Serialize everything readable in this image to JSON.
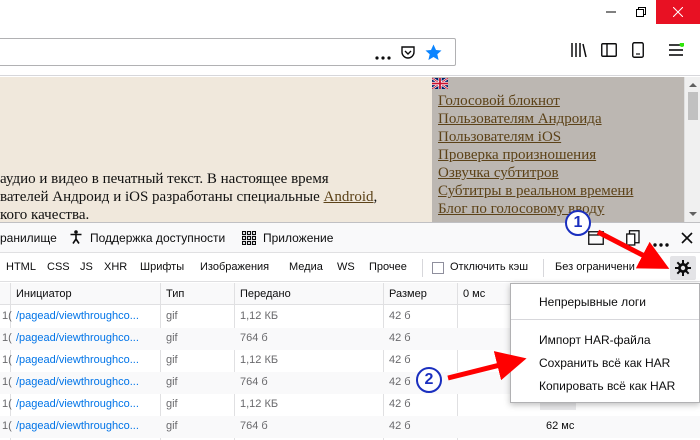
{
  "page": {
    "lines": [
      "аудио и видео в печатный текст. В настоящее время",
      "вателей Андроид и iOS разработаны специальные ",
      "кого качества."
    ],
    "android_link": "Android",
    "comma": ","
  },
  "sidebar": {
    "items": [
      "Голосовой блокнот",
      "Пользователям Андроида",
      "Пользователям iOS",
      "Проверка произношения",
      "Озвучка субтитров",
      "Субтитры в реальном времени",
      "Блог по голосовому вводу"
    ]
  },
  "devtools": {
    "tabs": [
      "ранилище",
      "Поддержка доступности",
      "Приложение"
    ],
    "filters": [
      "HTML",
      "CSS",
      "JS",
      "XHR",
      "Шрифты",
      "Изображения",
      "Медиа",
      "WS",
      "Прочее"
    ],
    "disable_cache": "Отключить кэш",
    "throttle": "Без ограничени",
    "columns": [
      "Инициатор",
      "Тип",
      "Передано",
      "Размер",
      "0 мс"
    ],
    "rows": [
      {
        "status": "1(",
        "initiator": "/pagead/viewthroughco...",
        "type": "gif",
        "transferred": "1,12 КБ",
        "size": "42 б"
      },
      {
        "status": "1(",
        "initiator": "/pagead/viewthroughco...",
        "type": "gif",
        "transferred": "764 б",
        "size": "42 б"
      },
      {
        "status": "1(",
        "initiator": "/pagead/viewthroughco...",
        "type": "gif",
        "transferred": "1,12 КБ",
        "size": "42 б"
      },
      {
        "status": "1(",
        "initiator": "/pagead/viewthroughco...",
        "type": "gif",
        "transferred": "764 б",
        "size": "42 б"
      },
      {
        "status": "1(",
        "initiator": "/pagead/viewthroughco...",
        "type": "gif",
        "transferred": "1,12 КБ",
        "size": "42 б"
      },
      {
        "status": "1(",
        "initiator": "/pagead/viewthroughco...",
        "type": "gif",
        "transferred": "764 б",
        "size": "42 б"
      }
    ],
    "waterfall_label": "62 мс"
  },
  "menu": {
    "items": [
      "Непрерывные логи",
      "Импорт HAR-файла",
      "Сохранить всё как HAR",
      "Копировать всё как HAR"
    ]
  },
  "annotations": {
    "badge1": "1",
    "badge2": "2"
  },
  "colors": {
    "accent": "#0a84ff",
    "badge": "#1a2fbf",
    "arrow": "#ff0000",
    "close": "#e81123"
  }
}
